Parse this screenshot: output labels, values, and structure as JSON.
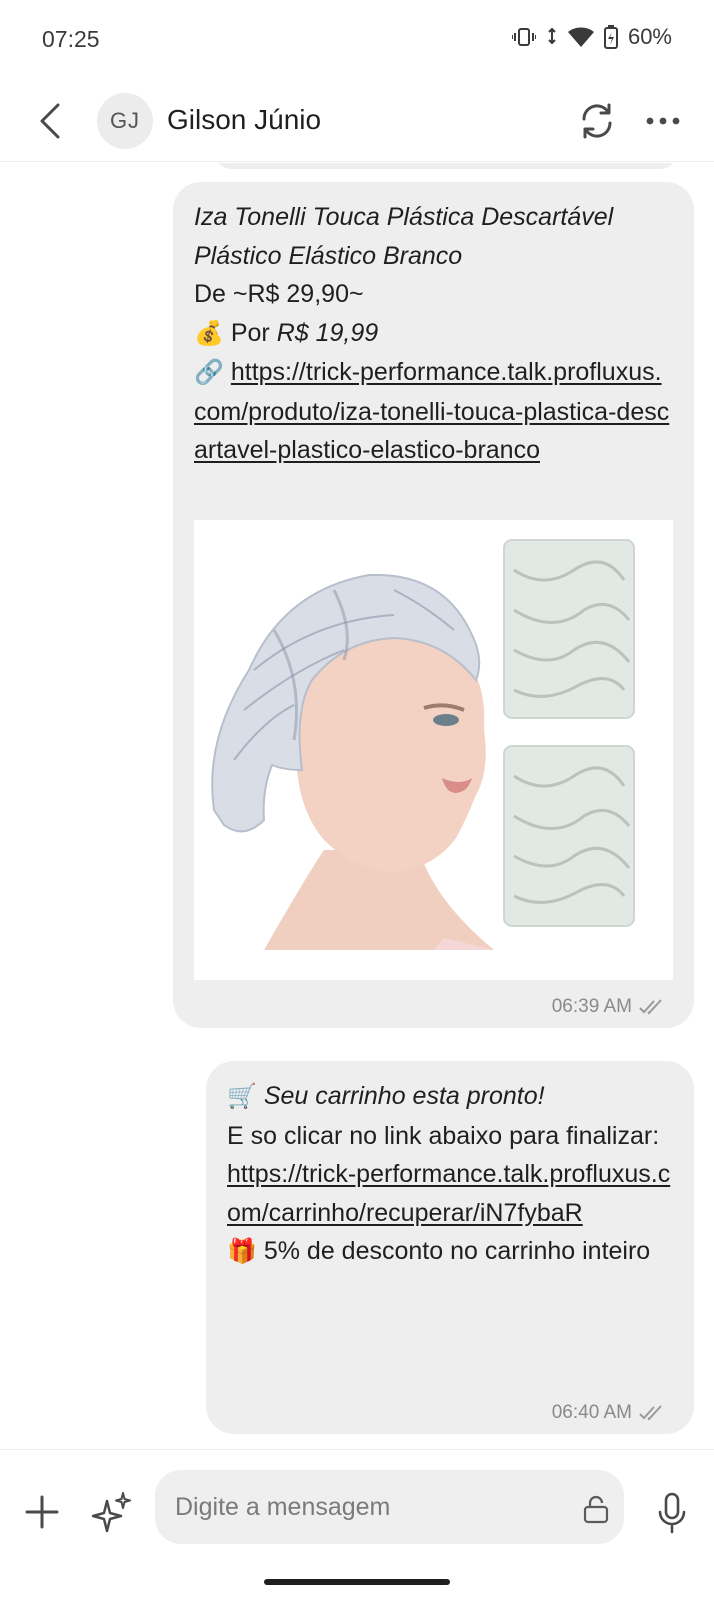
{
  "status_bar": {
    "time": "07:25",
    "battery": "60%"
  },
  "header": {
    "avatar_initials": "GJ",
    "contact_name": "Gilson Júnio"
  },
  "messages": [
    {
      "title_line1": "Iza Tonelli Touca Plástica Descartável",
      "title_line2": "Plástico Elástico Branco",
      "old_price": "De ~R$ 29,90~",
      "price_prefix": "Por",
      "price_emoji": "💰",
      "price": "R$ 19,99",
      "link_emoji": "🔗",
      "link": "https://trick-performance.talk.profluxus.com/produto/iza-tonelli-touca-plastica-descartavel-plastico-elastico-branco",
      "time": "06:39 AM"
    },
    {
      "cart_emoji": "🛒",
      "headline": "Seu carrinho esta pronto!",
      "body": "E so clicar no link abaixo para finalizar:",
      "link": "https://trick-performance.talk.profluxus.com/carrinho/recuperar/iN7fybaR",
      "gift_emoji": "🎁",
      "discount": "5% de desconto no carrinho inteiro",
      "time": "06:40 AM"
    }
  ],
  "composer": {
    "placeholder": "Digite a mensagem"
  },
  "colors": {
    "bubble": "#eeeeee",
    "text": "#1f1f1f",
    "meta": "#8a8a8a"
  }
}
